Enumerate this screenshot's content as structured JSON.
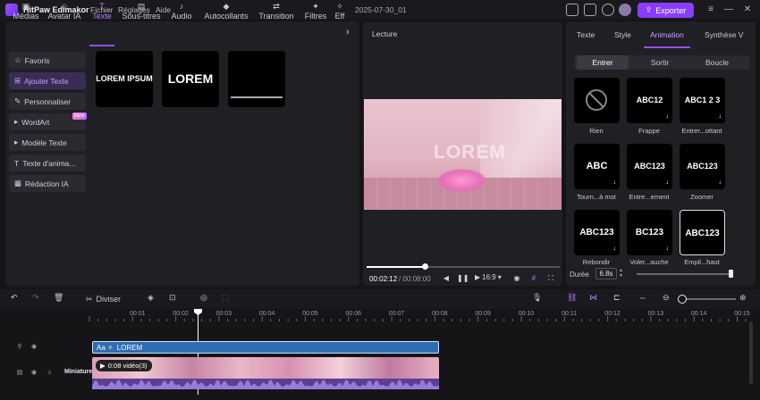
{
  "app": {
    "title": "HitPaw Edimakor",
    "menus": [
      "Fichier",
      "Réglages",
      "Aide"
    ],
    "project": "2025-07-30_01",
    "export_label": "Exporter"
  },
  "tabs": [
    {
      "label": "Médias",
      "icon": "media-icon"
    },
    {
      "label": "Avatar IA",
      "icon": "avatar-icon"
    },
    {
      "label": "Texte",
      "icon": "text-icon"
    },
    {
      "label": "Sous-titres",
      "icon": "subtitles-icon"
    },
    {
      "label": "Audio",
      "icon": "music-icon"
    },
    {
      "label": "Autocollants",
      "icon": "sticker-icon"
    },
    {
      "label": "Transition",
      "icon": "transition-icon"
    },
    {
      "label": "Filtres",
      "icon": "filter-icon"
    },
    {
      "label": "Eff",
      "icon": "effects-icon"
    }
  ],
  "sidebar": [
    {
      "label": "Favoris",
      "icon": "star-icon"
    },
    {
      "label": "Ajouter Texte",
      "icon": "add-text-icon"
    },
    {
      "label": "Personnaliser",
      "icon": "custom-icon"
    },
    {
      "label": "WordArt",
      "icon": "caret-icon",
      "badge": "NEW"
    },
    {
      "label": "Modèle Texte",
      "icon": "caret-icon"
    },
    {
      "label": "Texte d'anima...",
      "icon": "anim-text-icon"
    },
    {
      "label": "Rédaction IA",
      "icon": "ai-writing-icon"
    }
  ],
  "thumbs": [
    "LOREM IPSUM",
    "LOREM",
    ""
  ],
  "preview": {
    "label": "Lecture",
    "time_current": "00:02:12",
    "time_total": "/ 00:08:00",
    "ratio": "16:9",
    "progress": 0.29,
    "overlay_text": "LOREM"
  },
  "right": {
    "tabs": [
      "Texte",
      "Style",
      "Animation",
      "Synthèse V"
    ],
    "subtabs": [
      "Entrer",
      "Sortir",
      "Boucle"
    ],
    "animations": [
      {
        "preview": "",
        "label": "Rien"
      },
      {
        "preview": "ABC12",
        "label": "Frappe"
      },
      {
        "preview": "ABC1 2 3",
        "label": "Entrer...ottant"
      },
      {
        "preview": "ABC",
        "label": "Tourn...à mot"
      },
      {
        "preview": "ABC123",
        "label": "Entre...ement"
      },
      {
        "preview": "ABC123",
        "label": "Zoomer"
      },
      {
        "preview": "ABC123",
        "label": "Rebondir"
      },
      {
        "preview": "BC123",
        "label": "Voler...auche"
      },
      {
        "preview": "ABC123",
        "label": "Empil...haut"
      }
    ],
    "duree_label": "Durée",
    "duree_value": "6.8s",
    "duree_fraction": 0.96
  },
  "toolbar": {
    "split_label": "Diviser"
  },
  "timeline": {
    "ticks": [
      "00:01",
      "00:02",
      "00:03",
      "00:04",
      "00:05",
      "00:06",
      "00:07",
      "00:08",
      "00:09",
      "00:10",
      "00:11",
      "00:12",
      "00:13",
      "00:14",
      "00:15"
    ],
    "text_clip": "LOREM",
    "video_clip": "0:08 vidéo(3)",
    "track_label": "Miniature"
  }
}
